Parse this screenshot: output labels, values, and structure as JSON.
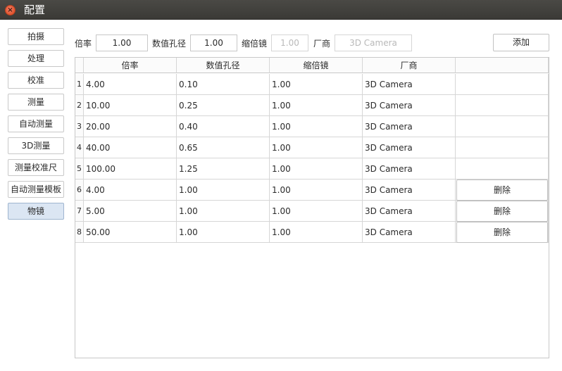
{
  "window": {
    "title": "配置"
  },
  "sidebar": {
    "items": [
      {
        "label": "拍摄",
        "active": false
      },
      {
        "label": "处理",
        "active": false
      },
      {
        "label": "校准",
        "active": false
      },
      {
        "label": "测量",
        "active": false
      },
      {
        "label": "自动测量",
        "active": false
      },
      {
        "label": "3D测量",
        "active": false
      },
      {
        "label": "测量校准尺",
        "active": false
      },
      {
        "label": "自动测量模板",
        "active": false
      },
      {
        "label": "物镜",
        "active": true
      }
    ]
  },
  "form": {
    "magnification_label": "倍率",
    "magnification_value": "1.00",
    "aperture_label": "数值孔径",
    "aperture_value": "1.00",
    "reducer_label": "缩倍镜",
    "reducer_value": "1.00",
    "vendor_label": "厂商",
    "vendor_placeholder": "3D Camera",
    "add_label": "添加"
  },
  "table": {
    "headers": [
      "倍率",
      "数值孔径",
      "缩倍镜",
      "厂商",
      ""
    ],
    "rows": [
      {
        "num": "1",
        "magnification": "4.00",
        "aperture": "0.10",
        "reducer": "1.00",
        "vendor": "3D Camera",
        "action": ""
      },
      {
        "num": "2",
        "magnification": "10.00",
        "aperture": "0.25",
        "reducer": "1.00",
        "vendor": "3D Camera",
        "action": ""
      },
      {
        "num": "3",
        "magnification": "20.00",
        "aperture": "0.40",
        "reducer": "1.00",
        "vendor": "3D Camera",
        "action": ""
      },
      {
        "num": "4",
        "magnification": "40.00",
        "aperture": "0.65",
        "reducer": "1.00",
        "vendor": "3D Camera",
        "action": ""
      },
      {
        "num": "5",
        "magnification": "100.00",
        "aperture": "1.25",
        "reducer": "1.00",
        "vendor": "3D Camera",
        "action": ""
      },
      {
        "num": "6",
        "magnification": "4.00",
        "aperture": "1.00",
        "reducer": "1.00",
        "vendor": "3D Camera",
        "action": "删除"
      },
      {
        "num": "7",
        "magnification": "5.00",
        "aperture": "1.00",
        "reducer": "1.00",
        "vendor": "3D Camera",
        "action": "删除"
      },
      {
        "num": "8",
        "magnification": "50.00",
        "aperture": "1.00",
        "reducer": "1.00",
        "vendor": "3D Camera",
        "action": "删除"
      }
    ]
  },
  "colors": {
    "titlebar": "#3f3e3a",
    "close_button": "#e0542e",
    "active_nav": "#dbe6f3",
    "border": "#c8c8c8"
  }
}
